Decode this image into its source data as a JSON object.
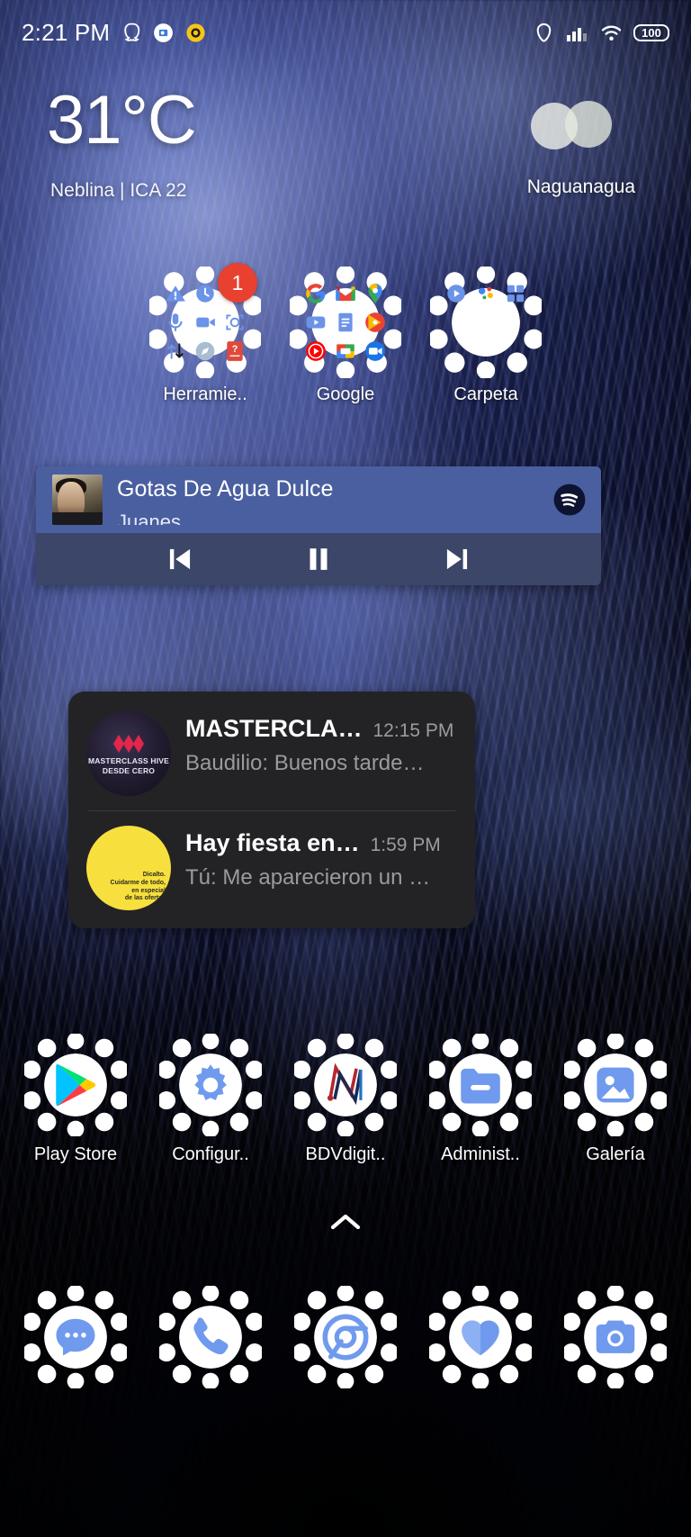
{
  "status_bar": {
    "clock": "2:21 PM",
    "left_icons": [
      {
        "name": "snapchat-icon"
      },
      {
        "name": "camera-notification-icon"
      },
      {
        "name": "brightness-sun-icon"
      }
    ],
    "right_icons": [
      {
        "name": "vpn-icon"
      },
      {
        "name": "signal-bars-icon"
      },
      {
        "name": "wifi-icon"
      }
    ],
    "battery_level": "100"
  },
  "weather": {
    "temperature": "31°C",
    "condition": "Neblina | ICA 22",
    "city": "Naguanagua",
    "icon": "fog-icon"
  },
  "folders": [
    {
      "label": "Herramie..",
      "badge": "1",
      "icons": [
        "warning-triangle-icon",
        "clock-icon",
        "",
        "microphone-icon",
        "screen-recorder-icon",
        "face-scan-icon",
        "file-transfer-icon",
        "compass-icon",
        "quiz-app-icon"
      ]
    },
    {
      "label": "Google",
      "badge": "",
      "icons": [
        "google-search-icon",
        "gmail-icon",
        "google-maps-icon",
        "youtube-icon",
        "google-docs-icon",
        "google-play-music-icon",
        "youtube-music-icon",
        "google-photos-icon",
        "google-meet-icon"
      ]
    },
    {
      "label": "Carpeta",
      "badge": "",
      "icons": [
        "play-circle-icon",
        "google-assistant-icon",
        "apps-grid-icon",
        "",
        "",
        "",
        "",
        "",
        ""
      ]
    }
  ],
  "music_widget": {
    "track_title": "Gotas De Agua Dulce",
    "artist": "Juanes",
    "app_icon": "spotify-icon",
    "controls": [
      {
        "name": "previous-track-button",
        "glyph": "skip-previous"
      },
      {
        "name": "pause-button",
        "glyph": "pause"
      },
      {
        "name": "next-track-button",
        "glyph": "skip-next"
      }
    ],
    "accent_color": "#4a5fa0",
    "controls_bar_color": "#3b4668"
  },
  "notifications": [
    {
      "avatar": "masterclass-hive-avatar",
      "avatar_text_line1": "MASTERCLASS HIVE",
      "avatar_text_line2": "DESDE CERO",
      "title": "MASTERCLA…",
      "time": "12:15 PM",
      "preview": "Baudilio: Buenos tarde…"
    },
    {
      "avatar": "yellow-group-avatar",
      "avatar_text_line1": "Dicalto.",
      "avatar_text_line2": "Cuidarme de todo,",
      "avatar_text_line3": "en especial",
      "avatar_text_line4": "de las ofertas",
      "title": "Hay fiesta en…",
      "time": "1:59 PM",
      "preview": "Tú: Me aparecieron un …"
    }
  ],
  "app_row": [
    {
      "label": "Play Store",
      "icon": "google-play-store-icon"
    },
    {
      "label": "Configur..",
      "icon": "settings-gear-icon"
    },
    {
      "label": "BDVdigit..",
      "icon": "bdvdigital-icon"
    },
    {
      "label": "Administ..",
      "icon": "file-manager-icon"
    },
    {
      "label": "Galería",
      "icon": "gallery-icon"
    }
  ],
  "dock": [
    {
      "label": "",
      "icon": "messages-icon"
    },
    {
      "label": "",
      "icon": "phone-icon"
    },
    {
      "label": "",
      "icon": "chrome-icon"
    },
    {
      "label": "",
      "icon": "health-heart-icon"
    },
    {
      "label": "",
      "icon": "camera-icon"
    }
  ],
  "drawer_indicator": "chevron-up-icon"
}
